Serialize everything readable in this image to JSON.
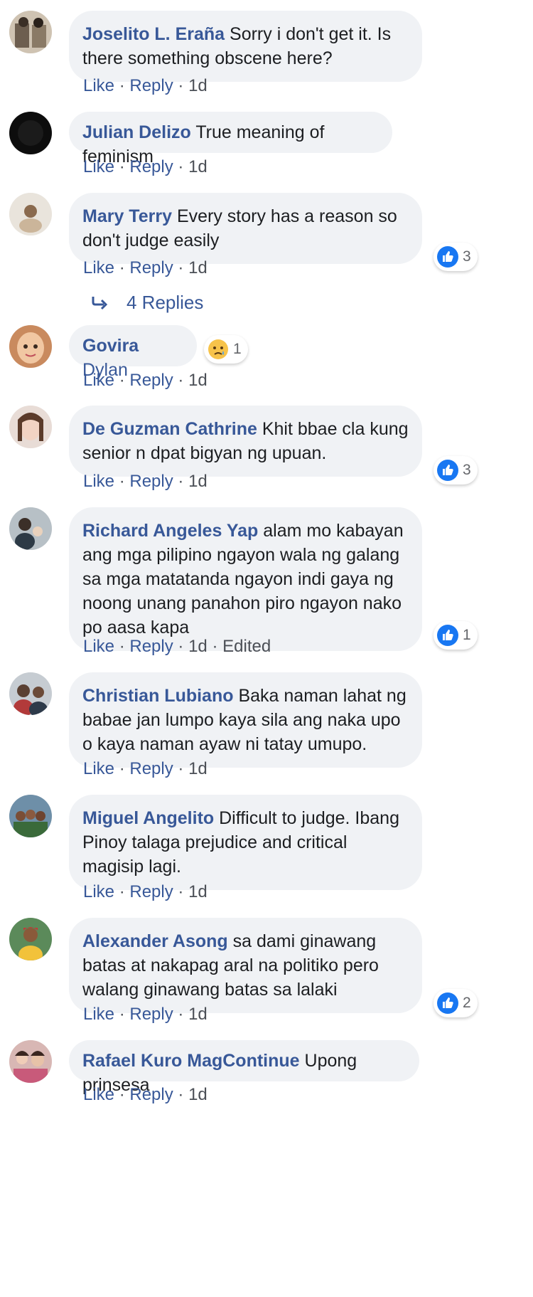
{
  "comments": [
    {
      "name": "Joselito L. Eraña",
      "text": "Sorry i don't get it. Is there something obscene here?",
      "like": "Like",
      "reply": "Reply",
      "time": "1d"
    },
    {
      "name": "Julian Delizo",
      "text": "True meaning of feminism",
      "like": "Like",
      "reply": "Reply",
      "time": "1d"
    },
    {
      "name": "Mary Terry",
      "text": "Every story has a reason so don't judge easily",
      "like": "Like",
      "reply": "Reply",
      "time": "1d",
      "reaction_count": "3"
    },
    {
      "name": "Govira",
      "text": "Dylan",
      "like": "Like",
      "reply": "Reply",
      "time": "1d",
      "reaction_count": "1"
    },
    {
      "name": "De Guzman Cathrine",
      "text": "Khit bbae cla kung senior n dpat bigyan ng upuan.",
      "like": "Like",
      "reply": "Reply",
      "time": "1d",
      "reaction_count": "3"
    },
    {
      "name": "Richard Angeles Yap",
      "text": "alam mo kabayan ang mga pilipino ngayon wala ng galang sa mga matatanda ngayon indi gaya ng noong unang panahon piro ngayon nako po aasa kapa",
      "like": "Like",
      "reply": "Reply",
      "time": "1d",
      "edited": "Edited",
      "reaction_count": "1"
    },
    {
      "name": "Christian Lubiano",
      "text": "Baka naman lahat ng babae jan lumpo kaya sila ang naka upo o kaya naman ayaw ni tatay umupo.",
      "like": "Like",
      "reply": "Reply",
      "time": "1d"
    },
    {
      "name": "Miguel Angelito",
      "text": "Difficult to judge. Ibang Pinoy talaga prejudice and critical magisip lagi.",
      "like": "Like",
      "reply": "Reply",
      "time": "1d"
    },
    {
      "name": "Alexander Asong",
      "text": "sa dami ginawang batas at nakapag aral na politiko pero walang ginawang batas sa lalaki",
      "like": "Like",
      "reply": "Reply",
      "time": "1d",
      "reaction_count": "2"
    },
    {
      "name": "Rafael Kuro MagContinue",
      "text": "Upong prinsesa",
      "like": "Like",
      "reply": "Reply",
      "time": "1d"
    }
  ],
  "replies_link": "4 Replies",
  "separator": "·",
  "colors": {
    "link": "#385898",
    "bubble": "#f0f2f5",
    "like_blue": "#1877f2"
  }
}
